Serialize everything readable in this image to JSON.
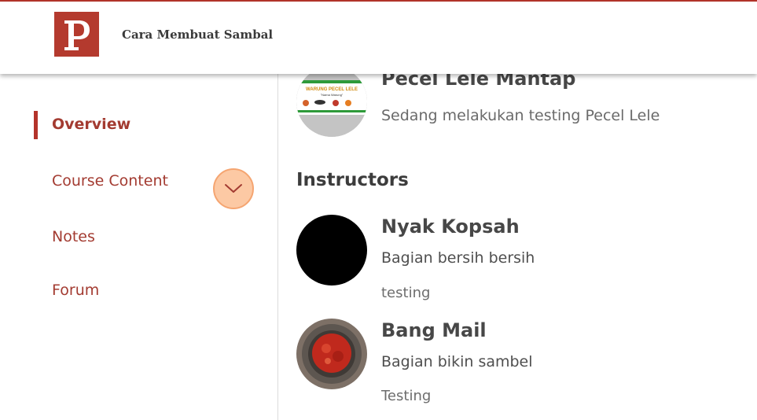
{
  "header": {
    "title": "Cara Membuat Sambal",
    "logo_letter": "P"
  },
  "sidebar": {
    "items": [
      {
        "label": "Overview",
        "active": true
      },
      {
        "label": "Course Content",
        "expandable": true
      },
      {
        "label": "Notes"
      },
      {
        "label": "Forum"
      }
    ]
  },
  "course": {
    "title": "Pecel Lele Mantap",
    "subtitle": "Sedang melakukan testing Pecel Lele",
    "banner_text": "WARUNG PECEL LELE",
    "banner_subtext": "\"Nama Warung\""
  },
  "instructors": {
    "heading": "Instructors",
    "list": [
      {
        "name": "Nyak Kopsah",
        "role": "Bagian bersih bersih",
        "description": "testing"
      },
      {
        "name": "Bang Mail",
        "role": "Bagian bikin sambel",
        "description": "Testing"
      }
    ]
  },
  "colors": {
    "brand": "#b4332a",
    "accent": "#fcc9a4"
  }
}
